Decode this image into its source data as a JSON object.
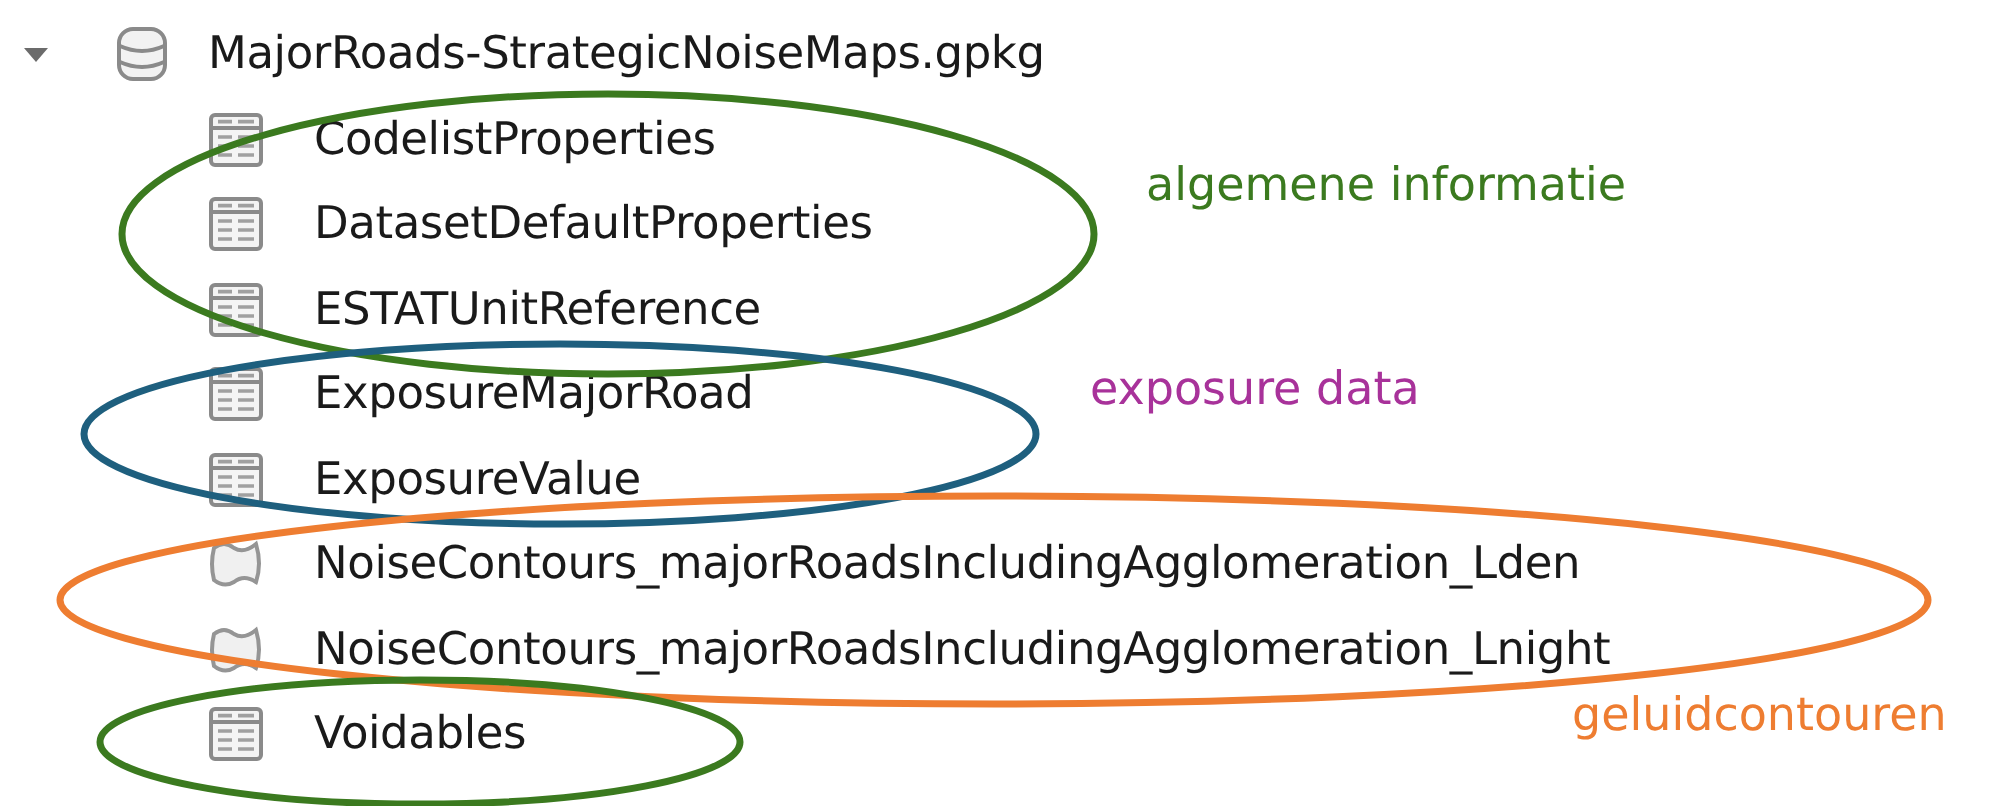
{
  "tree": {
    "label": "MajorRoads-StrategicNoiseMaps.gpkg",
    "kind": "database",
    "expanded": true,
    "children": [
      {
        "label": "CodelistProperties",
        "kind": "table"
      },
      {
        "label": "DatasetDefaultProperties",
        "kind": "table"
      },
      {
        "label": "ESTATUnitReference",
        "kind": "table"
      },
      {
        "label": "ExposureMajorRoad",
        "kind": "table"
      },
      {
        "label": "ExposureValue",
        "kind": "table"
      },
      {
        "label": "NoiseContours_majorRoadsIncludingAgglomeration_Lden",
        "kind": "polygon"
      },
      {
        "label": "NoiseContours_majorRoadsIncludingAgglomeration_Lnight",
        "kind": "polygon"
      },
      {
        "label": "Voidables",
        "kind": "table"
      }
    ]
  },
  "annotations": [
    {
      "color": "#3b7a1f",
      "label": {
        "text": "algemene informatie",
        "color": "#3b7a1f"
      }
    },
    {
      "color": "#1e5f7e",
      "label": {
        "text": "exposure data",
        "color": "#a8329a"
      }
    },
    {
      "color": "#ee7d31",
      "label": {
        "text": "geluidcontouren",
        "color": "#ee7d31"
      }
    },
    {
      "color": "#3b7a1f"
    }
  ]
}
